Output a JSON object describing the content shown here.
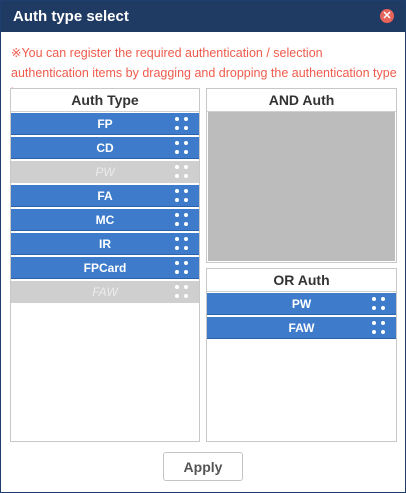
{
  "dialog": {
    "title": "Auth type select",
    "close_icon": "close-icon",
    "notice": "※You can register the required authentication / selection authentication items by dragging and dropping the authentication type items."
  },
  "auth_type": {
    "header": "Auth Type",
    "items": [
      {
        "label": "FP",
        "state": "active"
      },
      {
        "label": "CD",
        "state": "active"
      },
      {
        "label": "PW",
        "state": "disabled"
      },
      {
        "label": "FA",
        "state": "active"
      },
      {
        "label": "MC",
        "state": "active"
      },
      {
        "label": "IR",
        "state": "active"
      },
      {
        "label": "FPCard",
        "state": "active"
      },
      {
        "label": "FAW",
        "state": "disabled"
      }
    ]
  },
  "and_auth": {
    "header": "AND Auth"
  },
  "or_auth": {
    "header": "OR Auth",
    "items": [
      {
        "label": "PW",
        "state": "active"
      },
      {
        "label": "FAW",
        "state": "active"
      }
    ]
  },
  "footer": {
    "apply_label": "Apply"
  },
  "colors": {
    "titlebar": "#1f3b63",
    "active_item": "#3e7ccb",
    "disabled_item": "#cfcfcf",
    "notice_text": "#ef5b4c",
    "drop_area": "#bcbcbc"
  }
}
